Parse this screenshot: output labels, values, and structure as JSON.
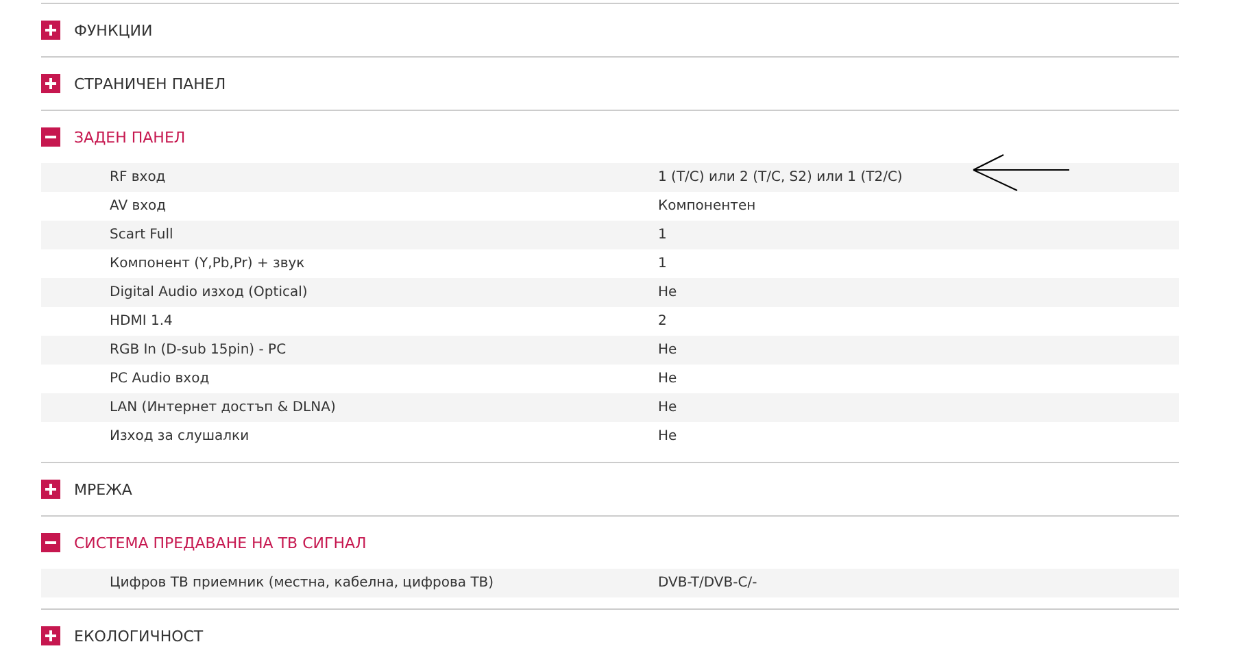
{
  "sections": [
    {
      "title": "ФУНКЦИИ",
      "expanded": false
    },
    {
      "title": "СТРАНИЧЕН ПАНЕЛ",
      "expanded": false
    },
    {
      "title": "ЗАДЕН ПАНЕЛ",
      "expanded": true,
      "rows": [
        {
          "label": "RF вход",
          "value": "1 (T/C) или 2 (T/C, S2) или 1 (T2/C)",
          "annotated": true
        },
        {
          "label": "AV вход",
          "value": "Компонентен"
        },
        {
          "label": "Scart Full",
          "value": "1"
        },
        {
          "label": "Компонент (Y,Pb,Pr) + звук",
          "value": "1"
        },
        {
          "label": "Digital Audio изход (Optical)",
          "value": "Не"
        },
        {
          "label": "HDMI 1.4",
          "value": "2"
        },
        {
          "label": "RGB In (D-sub 15pin) - PC",
          "value": "Не"
        },
        {
          "label": "PC Audio вход",
          "value": "Не"
        },
        {
          "label": "LAN (Интернет достъп & DLNA)",
          "value": "Не"
        },
        {
          "label": "Изход за слушалки",
          "value": "Не"
        }
      ]
    },
    {
      "title": "МРЕЖА",
      "expanded": false
    },
    {
      "title": "СИСТЕМА ПРЕДАВАНЕ НА ТВ СИГНАЛ",
      "expanded": true,
      "rows": [
        {
          "label": "Цифров ТВ приемник (местна, кабелна, цифрова ТВ)",
          "value": "DVB-T/DVB-C/-"
        }
      ]
    },
    {
      "title": "ЕКОЛОГИЧНОСТ",
      "expanded": false
    }
  ]
}
